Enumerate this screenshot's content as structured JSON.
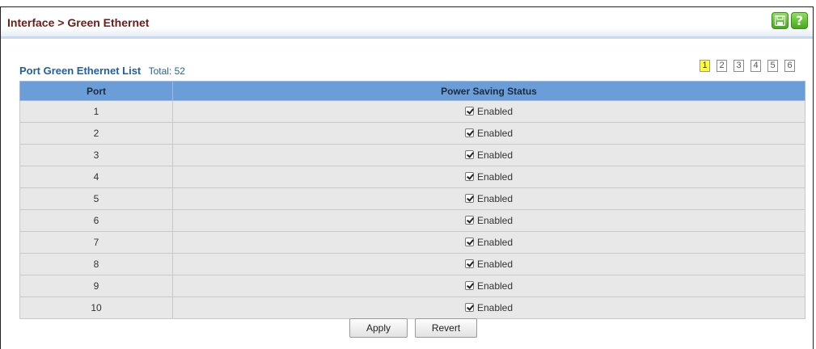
{
  "header": {
    "breadcrumb": "Interface > Green Ethernet"
  },
  "list": {
    "title": "Port Green Ethernet List",
    "total": "Total: 52"
  },
  "pager": {
    "pages": [
      "1",
      "2",
      "3",
      "4",
      "5",
      "6"
    ],
    "active": "1"
  },
  "table": {
    "columns": [
      "Port",
      "Power Saving Status"
    ],
    "rows": [
      {
        "port": "1",
        "status": "Enabled",
        "checked": true
      },
      {
        "port": "2",
        "status": "Enabled",
        "checked": true
      },
      {
        "port": "3",
        "status": "Enabled",
        "checked": true
      },
      {
        "port": "4",
        "status": "Enabled",
        "checked": true
      },
      {
        "port": "5",
        "status": "Enabled",
        "checked": true
      },
      {
        "port": "6",
        "status": "Enabled",
        "checked": true
      },
      {
        "port": "7",
        "status": "Enabled",
        "checked": true
      },
      {
        "port": "8",
        "status": "Enabled",
        "checked": true
      },
      {
        "port": "9",
        "status": "Enabled",
        "checked": true
      },
      {
        "port": "10",
        "status": "Enabled",
        "checked": true
      }
    ]
  },
  "buttons": {
    "apply": "Apply",
    "revert": "Revert"
  },
  "icons": {
    "save": "save-icon",
    "help": "help-icon"
  },
  "colors": {
    "breadcrumb": "#6b1c1c",
    "header_row": "#6b9ed8",
    "icon_green": "#46a81e",
    "active_page": "#ffff33"
  }
}
